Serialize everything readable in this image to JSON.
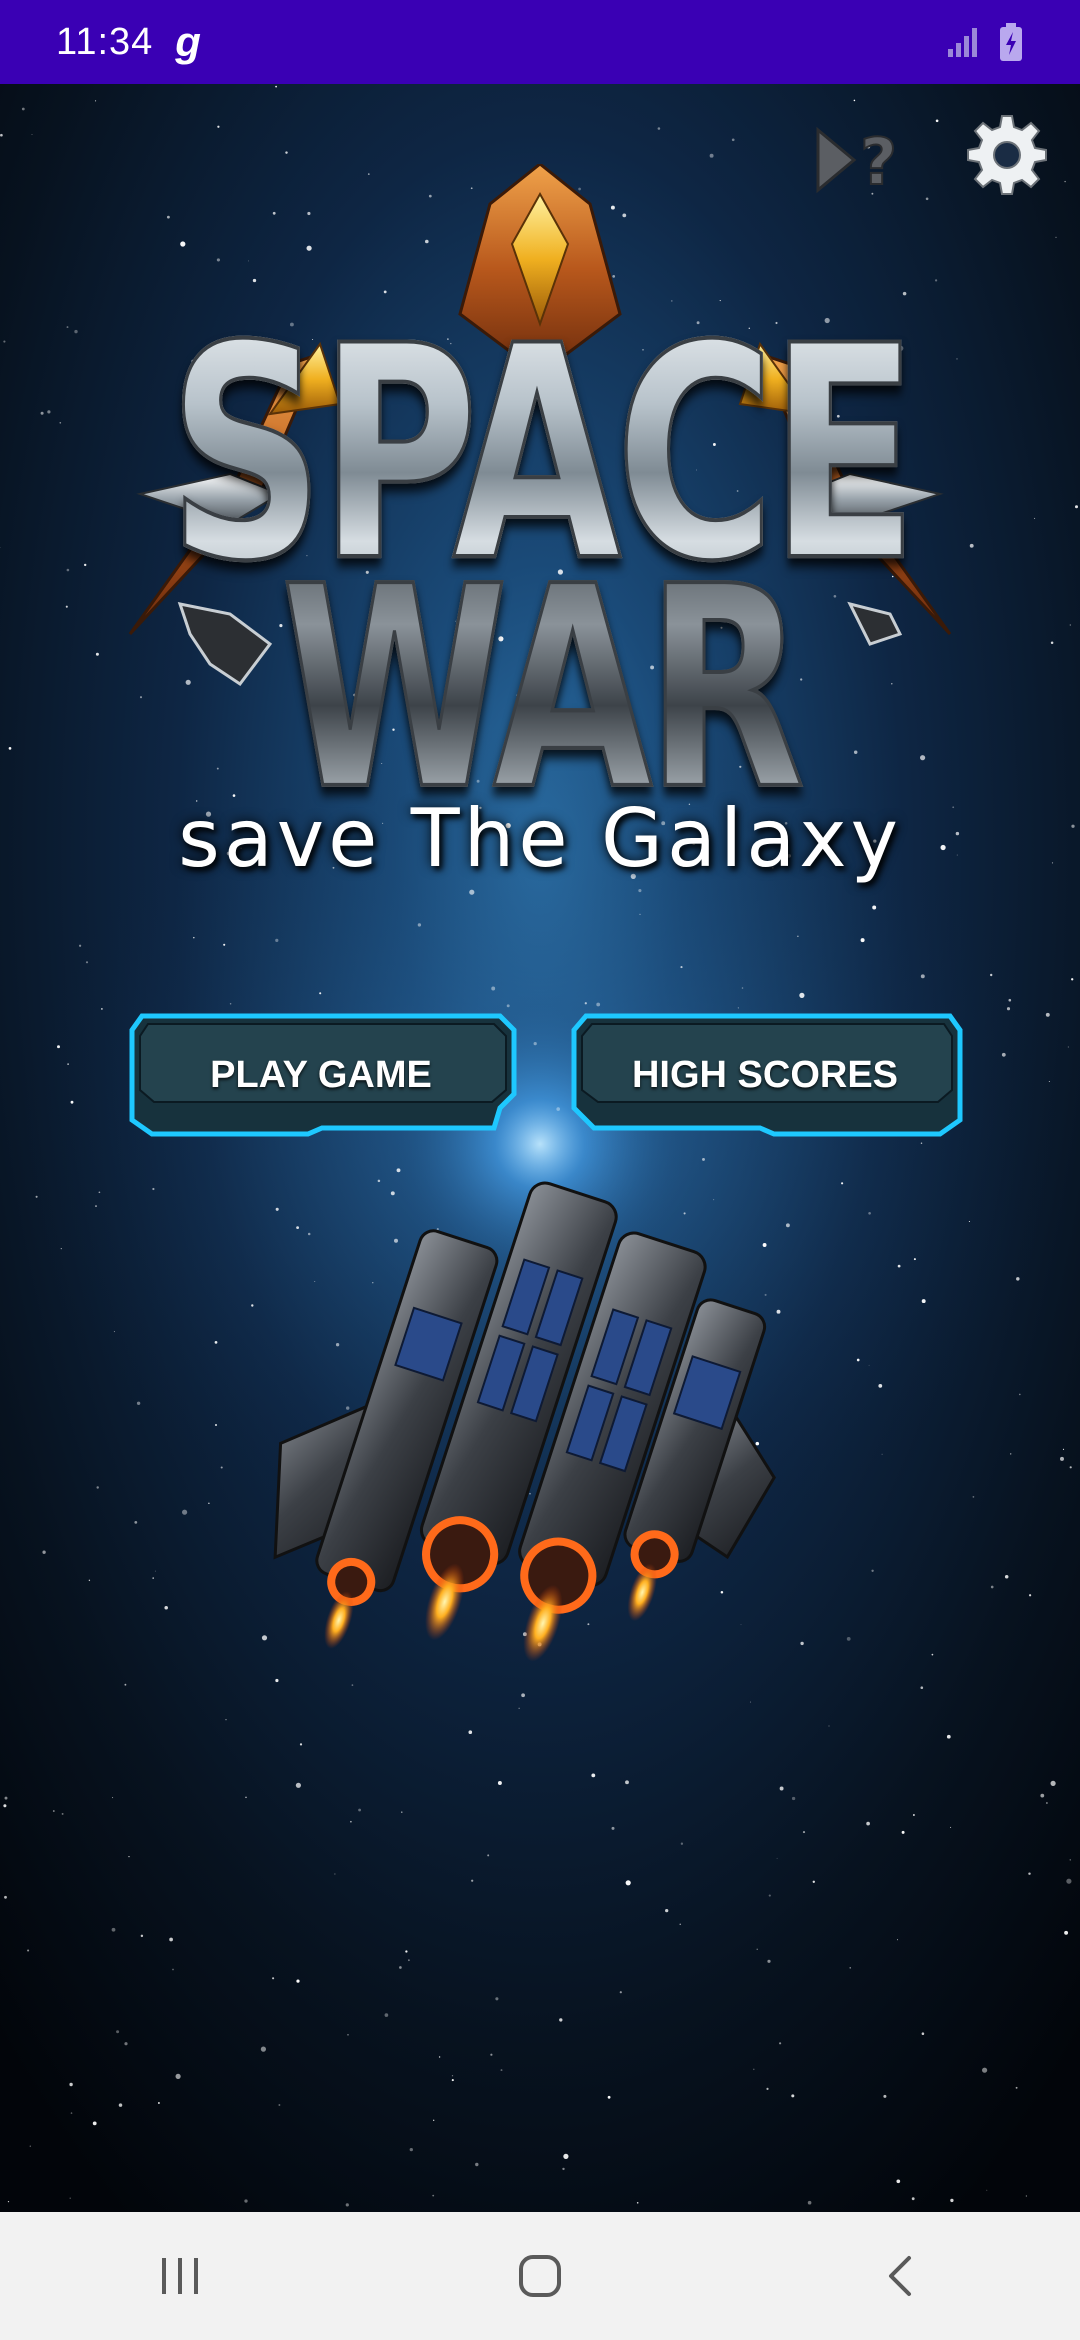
{
  "status_bar": {
    "time": "11:34",
    "app_indicator": "g",
    "bg_color": "#3a00b4",
    "icons": [
      "signal-icon",
      "battery-charging-icon"
    ]
  },
  "game": {
    "title_line1": "SPACE",
    "title_line2": "WAR",
    "tagline": "save The Galaxy",
    "top_icons": [
      "play-help-icon",
      "settings-gear-icon"
    ]
  },
  "menu": {
    "play_label": "PLAY GAME",
    "scores_label": "HIGH SCORES",
    "accent_color": "#1ec8ff"
  },
  "nav_bar": {
    "icons": [
      "recent-apps-icon",
      "home-icon",
      "back-icon"
    ]
  }
}
